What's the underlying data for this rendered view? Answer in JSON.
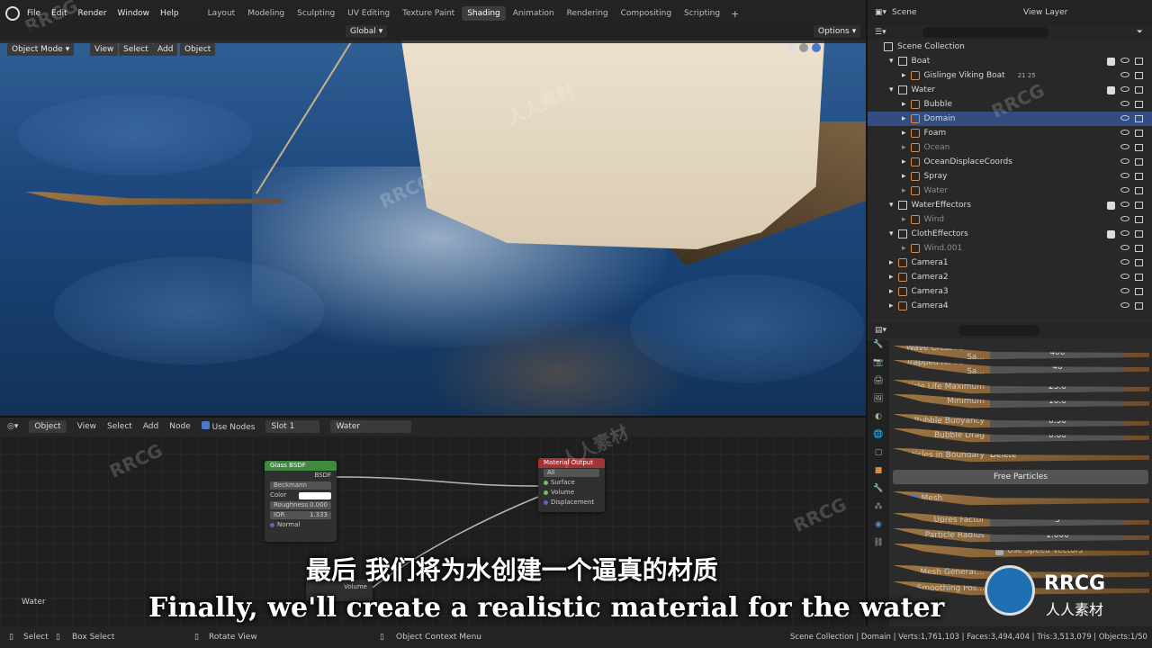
{
  "topbar": {
    "menus": [
      "File",
      "Edit",
      "Render",
      "Window",
      "Help"
    ],
    "workspaces": [
      "Layout",
      "Modeling",
      "Sculpting",
      "UV Editing",
      "Texture Paint",
      "Shading",
      "Animation",
      "Rendering",
      "Compositing",
      "Scripting"
    ],
    "active_workspace": "Shading",
    "plus": "+"
  },
  "viewport_header": {
    "mode": "Object Mode",
    "view": "View",
    "select": "Select",
    "add": "Add",
    "object": "Object",
    "orientation": "Global",
    "options": "Options"
  },
  "node_header": {
    "type": "Object",
    "view": "View",
    "select": "Select",
    "add": "Add",
    "node": "Node",
    "use_nodes": "Use Nodes",
    "slot": "Slot 1",
    "material": "Water"
  },
  "nodes": {
    "glass": {
      "title": "Glass BSDF",
      "output": "BSDF",
      "distribution": "Beckmann",
      "color_label": "Color",
      "roughness_label": "Roughness",
      "roughness_value": "0.000",
      "ior_label": "IOR",
      "ior_value": "1.333",
      "normal_label": "Normal"
    },
    "output": {
      "title": "Material Output",
      "target": "All",
      "surface": "Surface",
      "volume": "Volume",
      "displacement": "Displacement"
    },
    "lower_label": "Volume"
  },
  "node_editor_label": "Water",
  "outliner": {
    "scene": "Scene",
    "view_layer": "View Layer",
    "scene_collection": "Scene Collection",
    "rows": [
      {
        "label": "Boat",
        "depth": 1,
        "kind": "collection"
      },
      {
        "label": "Gislinge Viking Boat",
        "depth": 2,
        "kind": "object",
        "extra": "21 25"
      },
      {
        "label": "Water",
        "depth": 1,
        "kind": "collection"
      },
      {
        "label": "Bubble",
        "depth": 2,
        "kind": "mesh"
      },
      {
        "label": "Domain",
        "depth": 2,
        "kind": "mesh",
        "selected": true
      },
      {
        "label": "Foam",
        "depth": 2,
        "kind": "mesh"
      },
      {
        "label": "Ocean",
        "depth": 2,
        "kind": "mesh",
        "dim": true
      },
      {
        "label": "OceanDisplaceCoords",
        "depth": 2,
        "kind": "mesh"
      },
      {
        "label": "Spray",
        "depth": 2,
        "kind": "mesh"
      },
      {
        "label": "Water",
        "depth": 2,
        "kind": "mesh",
        "dim": true
      },
      {
        "label": "WaterEffectors",
        "depth": 1,
        "kind": "collection"
      },
      {
        "label": "Wind",
        "depth": 2,
        "kind": "object",
        "dim": true
      },
      {
        "label": "ClothEffectors",
        "depth": 1,
        "kind": "collection"
      },
      {
        "label": "Wind.001",
        "depth": 2,
        "kind": "object",
        "dim": true
      },
      {
        "label": "Camera1",
        "depth": 1,
        "kind": "camera"
      },
      {
        "label": "Camera2",
        "depth": 1,
        "kind": "camera"
      },
      {
        "label": "Camera3",
        "depth": 1,
        "kind": "camera"
      },
      {
        "label": "Camera4",
        "depth": 1,
        "kind": "camera"
      }
    ]
  },
  "properties": {
    "rows": [
      {
        "label": "Wave Crest Particle Sa...",
        "value": "400"
      },
      {
        "label": "Trapped Air Particle Sa...",
        "value": "40"
      },
      {
        "label": "Particle Life Maximum",
        "value": "25.0"
      },
      {
        "label": "Minimum",
        "value": "10.0"
      },
      {
        "label": "Bubble Buoyancy",
        "value": "0.50"
      },
      {
        "label": "Bubble Drag",
        "value": "0.60"
      },
      {
        "label": "Particles in Boundary",
        "value": "Delete"
      }
    ],
    "free_particles": "Free Particles",
    "mesh_section": "Mesh",
    "mesh_rows": [
      {
        "label": "Upres Factor",
        "value": "3"
      },
      {
        "label": "Particle Radius",
        "value": "1.000"
      }
    ],
    "use_speed_vectors": "Use Speed Vectors",
    "mesh_generator": "Mesh Generat...",
    "smoothing_pos": "Smoothing Pos..."
  },
  "statusbar": {
    "select": "Select",
    "box_select": "Box Select",
    "rotate_view": "Rotate View",
    "context_menu": "Object Context Menu",
    "stats": "Scene Collection | Domain | Verts:1,761,103 | Faces:3,494,404 | Tris:3,513,079 | Objects:1/50"
  },
  "subtitles": {
    "chinese": "最后 我们将为水创建一个逼真的材质",
    "english": "Finally, we'll create a realistic material for the water"
  },
  "watermarks": {
    "brand": "RRCG",
    "cn": "人人素材"
  },
  "colors": {
    "selection": "#334d80",
    "glass_header": "#3f8a3f",
    "output_header": "#a33434",
    "water": "#1f4a80"
  }
}
